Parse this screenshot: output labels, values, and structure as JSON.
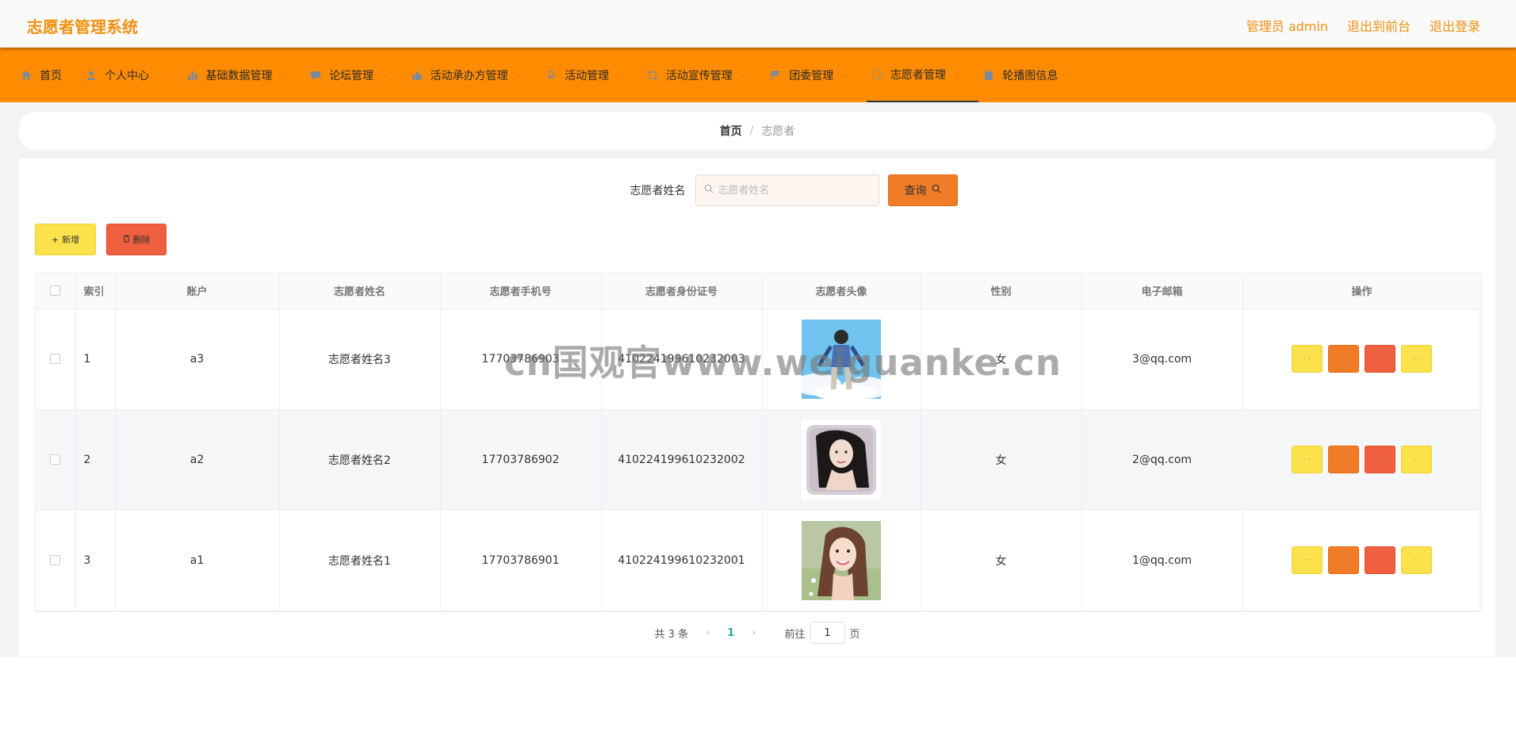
{
  "header": {
    "title": "志愿者管理系统",
    "admin_label": "管理员 admin",
    "to_front": "退出到前台",
    "logout": "退出登录"
  },
  "nav": [
    {
      "label": "首页",
      "icon": "home-icon",
      "has_dropdown": false
    },
    {
      "label": "个人中心",
      "icon": "user-icon",
      "has_dropdown": true
    },
    {
      "label": "基础数据管理",
      "icon": "bar-chart-icon",
      "has_dropdown": true
    },
    {
      "label": "论坛管理",
      "icon": "chat-icon",
      "has_dropdown": true
    },
    {
      "label": "活动承办方管理",
      "icon": "thumbs-up-icon",
      "has_dropdown": true
    },
    {
      "label": "活动管理",
      "icon": "microphone-icon",
      "has_dropdown": true
    },
    {
      "label": "活动宣传管理",
      "icon": "crop-icon",
      "has_dropdown": true
    },
    {
      "label": "团委管理",
      "icon": "flag-icon",
      "has_dropdown": true
    },
    {
      "label": "志愿者管理",
      "icon": "loading-icon",
      "has_dropdown": true,
      "active": true
    },
    {
      "label": "轮播图信息",
      "icon": "clipboard-icon",
      "has_dropdown": true
    }
  ],
  "breadcrumb": {
    "home": "首页",
    "separator": "/",
    "current": "志愿者"
  },
  "search": {
    "label": "志愿者姓名",
    "placeholder": "志愿者姓名",
    "button": "查询"
  },
  "actions": {
    "add": "新增",
    "delete": "删除"
  },
  "table": {
    "columns": [
      "索引",
      "账户",
      "志愿者姓名",
      "志愿者手机号",
      "志愿者身份证号",
      "志愿者头像",
      "性别",
      "电子邮箱",
      "操作"
    ],
    "rows": [
      {
        "index": "1",
        "account": "a3",
        "name": "志愿者姓名3",
        "phone": "17703786903",
        "id_card": "410224199610232003",
        "avatar": "boy-sky-avatar",
        "gender": "女",
        "email": "3@qq.com"
      },
      {
        "index": "2",
        "account": "a2",
        "name": "志愿者姓名2",
        "phone": "17703786902",
        "id_card": "410224199610232002",
        "avatar": "woman-pillow-avatar",
        "gender": "女",
        "email": "2@qq.com"
      },
      {
        "index": "3",
        "account": "a1",
        "name": "志愿者姓名1",
        "phone": "17703786901",
        "id_card": "410224199610232001",
        "avatar": "girl-field-avatar",
        "gender": "女",
        "email": "1@qq.com"
      }
    ]
  },
  "pagination": {
    "total": "共 3 条",
    "current_page": "1",
    "goto_label": "前往",
    "goto_value": "1",
    "page_unit": "页"
  },
  "watermark": "cn国观官www.weiguanke.cn",
  "colors": {
    "accent": "#f29111",
    "nav_bg": "#ff8c00",
    "yellow_btn": "#fbe14c",
    "orange_btn": "#f07c27",
    "red_btn": "#ee603f"
  }
}
